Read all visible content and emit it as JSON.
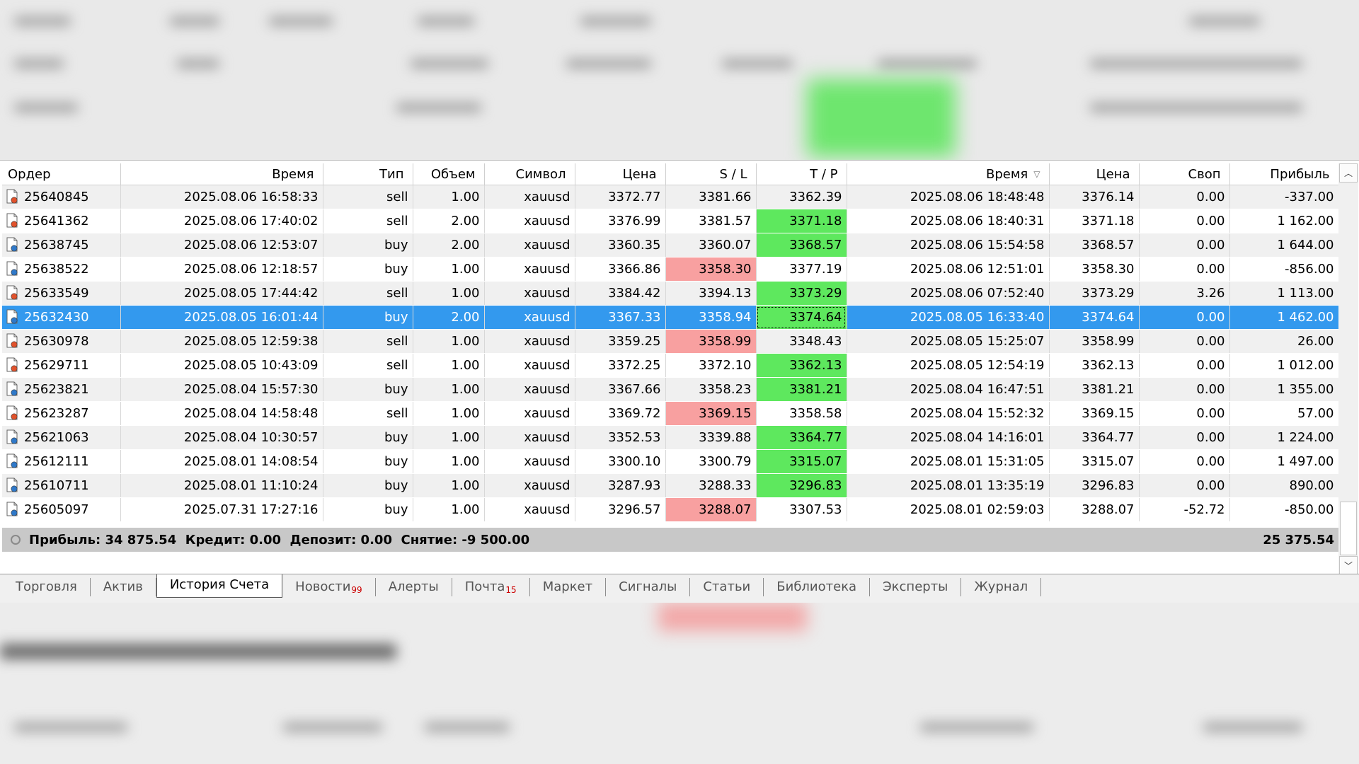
{
  "columns": [
    "Ордер",
    "Время",
    "Тип",
    "Объем",
    "Символ",
    "Цена",
    "S / L",
    "T / P",
    "Время",
    "Цена",
    "Своп",
    "Прибыль"
  ],
  "sort_indicator_icon": "sort-descending-icon",
  "rows": [
    {
      "order": "25640845",
      "open_time": "2025.08.06 16:58:33",
      "type": "sell",
      "volume": "1.00",
      "symbol": "xauusd",
      "open_price": "3372.77",
      "sl": "3381.66",
      "tp": "3362.39",
      "close_time": "2025.08.06 18:48:48",
      "close_price": "3376.14",
      "swap": "0.00",
      "profit": "-337.00",
      "hit": "none",
      "icon": "sell-order-icon"
    },
    {
      "order": "25641362",
      "open_time": "2025.08.06 17:40:02",
      "type": "sell",
      "volume": "2.00",
      "symbol": "xauusd",
      "open_price": "3376.99",
      "sl": "3381.57",
      "tp": "3371.18",
      "close_time": "2025.08.06 18:40:31",
      "close_price": "3371.18",
      "swap": "0.00",
      "profit": "1 162.00",
      "hit": "tp",
      "icon": "sell-order-icon"
    },
    {
      "order": "25638745",
      "open_time": "2025.08.06 12:53:07",
      "type": "buy",
      "volume": "2.00",
      "symbol": "xauusd",
      "open_price": "3360.35",
      "sl": "3360.07",
      "tp": "3368.57",
      "close_time": "2025.08.06 15:54:58",
      "close_price": "3368.57",
      "swap": "0.00",
      "profit": "1 644.00",
      "hit": "tp",
      "icon": "buy-order-icon"
    },
    {
      "order": "25638522",
      "open_time": "2025.08.06 12:18:57",
      "type": "buy",
      "volume": "1.00",
      "symbol": "xauusd",
      "open_price": "3366.86",
      "sl": "3358.30",
      "tp": "3377.19",
      "close_time": "2025.08.06 12:51:01",
      "close_price": "3358.30",
      "swap": "0.00",
      "profit": "-856.00",
      "hit": "sl",
      "icon": "buy-order-icon"
    },
    {
      "order": "25633549",
      "open_time": "2025.08.05 17:44:42",
      "type": "sell",
      "volume": "1.00",
      "symbol": "xauusd",
      "open_price": "3384.42",
      "sl": "3394.13",
      "tp": "3373.29",
      "close_time": "2025.08.06 07:52:40",
      "close_price": "3373.29",
      "swap": "3.26",
      "profit": "1 113.00",
      "hit": "tp",
      "icon": "sell-order-icon"
    },
    {
      "order": "25632430",
      "open_time": "2025.08.05 16:01:44",
      "type": "buy",
      "volume": "2.00",
      "symbol": "xauusd",
      "open_price": "3367.33",
      "sl": "3358.94",
      "tp": "3374.64",
      "close_time": "2025.08.05 16:33:40",
      "close_price": "3374.64",
      "swap": "0.00",
      "profit": "1 462.00",
      "hit": "tp",
      "selected": true,
      "icon": "buy-order-icon"
    },
    {
      "order": "25630978",
      "open_time": "2025.08.05 12:59:38",
      "type": "sell",
      "volume": "1.00",
      "symbol": "xauusd",
      "open_price": "3359.25",
      "sl": "3358.99",
      "tp": "3348.43",
      "close_time": "2025.08.05 15:25:07",
      "close_price": "3358.99",
      "swap": "0.00",
      "profit": "26.00",
      "hit": "sl",
      "icon": "sell-order-icon"
    },
    {
      "order": "25629711",
      "open_time": "2025.08.05 10:43:09",
      "type": "sell",
      "volume": "1.00",
      "symbol": "xauusd",
      "open_price": "3372.25",
      "sl": "3372.10",
      "tp": "3362.13",
      "close_time": "2025.08.05 12:54:19",
      "close_price": "3362.13",
      "swap": "0.00",
      "profit": "1 012.00",
      "hit": "tp",
      "icon": "sell-order-icon"
    },
    {
      "order": "25623821",
      "open_time": "2025.08.04 15:57:30",
      "type": "buy",
      "volume": "1.00",
      "symbol": "xauusd",
      "open_price": "3367.66",
      "sl": "3358.23",
      "tp": "3381.21",
      "close_time": "2025.08.04 16:47:51",
      "close_price": "3381.21",
      "swap": "0.00",
      "profit": "1 355.00",
      "hit": "tp",
      "icon": "buy-order-icon"
    },
    {
      "order": "25623287",
      "open_time": "2025.08.04 14:58:48",
      "type": "sell",
      "volume": "1.00",
      "symbol": "xauusd",
      "open_price": "3369.72",
      "sl": "3369.15",
      "tp": "3358.58",
      "close_time": "2025.08.04 15:52:32",
      "close_price": "3369.15",
      "swap": "0.00",
      "profit": "57.00",
      "hit": "sl",
      "icon": "sell-order-icon"
    },
    {
      "order": "25621063",
      "open_time": "2025.08.04 10:30:57",
      "type": "buy",
      "volume": "1.00",
      "symbol": "xauusd",
      "open_price": "3352.53",
      "sl": "3339.88",
      "tp": "3364.77",
      "close_time": "2025.08.04 14:16:01",
      "close_price": "3364.77",
      "swap": "0.00",
      "profit": "1 224.00",
      "hit": "tp",
      "icon": "buy-order-icon"
    },
    {
      "order": "25612111",
      "open_time": "2025.08.01 14:08:54",
      "type": "buy",
      "volume": "1.00",
      "symbol": "xauusd",
      "open_price": "3300.10",
      "sl": "3300.79",
      "tp": "3315.07",
      "close_time": "2025.08.01 15:31:05",
      "close_price": "3315.07",
      "swap": "0.00",
      "profit": "1 497.00",
      "hit": "tp",
      "icon": "buy-order-icon"
    },
    {
      "order": "25610711",
      "open_time": "2025.08.01 11:10:24",
      "type": "buy",
      "volume": "1.00",
      "symbol": "xauusd",
      "open_price": "3287.93",
      "sl": "3288.33",
      "tp": "3296.83",
      "close_time": "2025.08.01 13:35:19",
      "close_price": "3296.83",
      "swap": "0.00",
      "profit": "890.00",
      "hit": "tp",
      "icon": "buy-order-icon"
    },
    {
      "order": "25605097",
      "open_time": "2025.07.31 17:27:16",
      "type": "buy",
      "volume": "1.00",
      "symbol": "xauusd",
      "open_price": "3296.57",
      "sl": "3288.07",
      "tp": "3307.53",
      "close_time": "2025.08.01 02:59:03",
      "close_price": "3288.07",
      "swap": "-52.72",
      "profit": "-850.00",
      "hit": "sl",
      "icon": "buy-order-icon"
    }
  ],
  "summary": {
    "text": "Прибыль: 34 875.54  Кредит: 0.00  Депозит: 0.00  Снятие: -9 500.00",
    "total": "25 375.54"
  },
  "tabs": [
    {
      "label": "Торговля"
    },
    {
      "label": "Актив"
    },
    {
      "label": "История Счета",
      "active": true
    },
    {
      "label": "Новости",
      "badge": "99"
    },
    {
      "label": "Алерты"
    },
    {
      "label": "Почта",
      "badge": "15"
    },
    {
      "label": "Маркет"
    },
    {
      "label": "Сигналы"
    },
    {
      "label": "Статьи"
    },
    {
      "label": "Библиотека"
    },
    {
      "label": "Эксперты"
    },
    {
      "label": "Журнал"
    }
  ],
  "colors": {
    "selected_row": "#3399ee",
    "tp_hit": "#5ee85e",
    "sl_hit": "#f8a0a0",
    "summary_bg": "#c8c8c8",
    "sell_icon": "#e0522c",
    "buy_icon": "#2f78c8"
  }
}
